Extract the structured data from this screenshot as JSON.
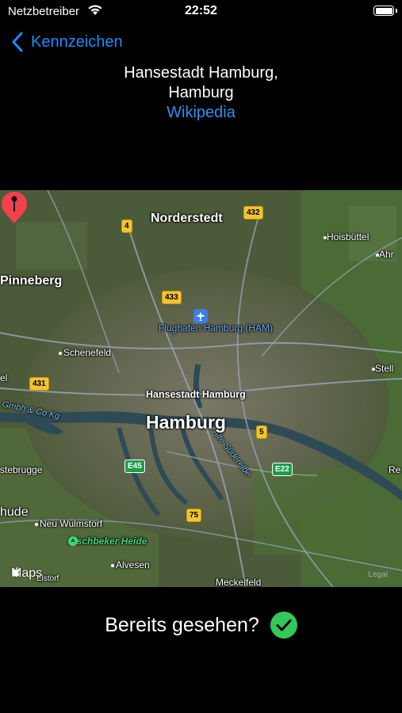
{
  "status": {
    "carrier": "Netzbetreiber",
    "time": "22:52"
  },
  "nav": {
    "back_label": "Kennzeichen"
  },
  "header": {
    "title_line1": "Hansestadt Hamburg,",
    "title_line2": "Hamburg",
    "link": "Wikipedia"
  },
  "map": {
    "pin_label": "Hansestadt Hamburg",
    "city": "Hamburg",
    "places": {
      "norderstedt": "Norderstedt",
      "pinneberg": "Pinneberg",
      "schenefeld": "Schenefeld",
      "hoisbuettel": "Hoisbüttel",
      "ahr": "Ahr",
      "stell": "Stell",
      "el": "el",
      "stebrugge": "stebrugge",
      "hude": "hude",
      "neu_wulmstorf": "Neu Wulmstorf",
      "alvesen": "Alvesen",
      "meckelfeld": "Meckelfeld",
      "re": "Re",
      "elstorf": "Elstorf"
    },
    "water_label_left": "Gmbh & Co Kg",
    "water_label_river": "Alte Süderelbe",
    "airport": "Flughafen Hamburg (HAM)",
    "park": "Fischbeker Heide",
    "shields": {
      "s4": "4",
      "s432": "432",
      "s433": "433",
      "s431": "431",
      "s5": "5",
      "e45": "E45",
      "e22": "E22",
      "s75": "75"
    },
    "attribution": "Maps",
    "legal": "Legal"
  },
  "seen": {
    "label": "Bereits gesehen?"
  },
  "colors": {
    "accent": "#2f8ff5",
    "check": "#34c759",
    "pin": "#f2414b"
  }
}
